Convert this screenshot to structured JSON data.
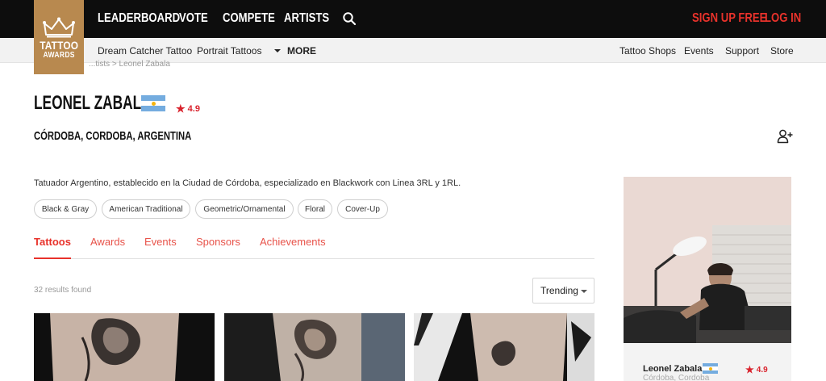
{
  "logo": {
    "line1": "TATTOO",
    "line2": "AWARDS",
    "icon": "crown-icon"
  },
  "nav": {
    "items": [
      "LEADERBOARD",
      "VOTE",
      "COMPETE",
      "ARTISTS"
    ],
    "search_icon": "search-icon",
    "signup": "SIGN UP FREE",
    "login": "LOG IN"
  },
  "subnav": {
    "left": [
      "Dream Catcher Tattoo",
      "Portrait Tattoos"
    ],
    "more": "MORE",
    "right": [
      "Tattoo Shops",
      "Events",
      "Support",
      "Store"
    ]
  },
  "breadcrumb": "...tists  >  Leonel Zabala",
  "profile": {
    "name": "LEONEL ZABALA",
    "flag": "Argentina",
    "rating": "4.9",
    "location": "CÓRDOBA, CORDOBA, ARGENTINA",
    "follow_icon": "add-user-icon",
    "bio": "Tatuador Argentino, establecido en la Ciudad de Córdoba, especializado en Blackwork con Linea 3RL y 1RL.",
    "tags": [
      "Black & Gray",
      "American Traditional",
      "Geometric/Ornamental",
      "Floral",
      "Cover-Up"
    ]
  },
  "tabs": [
    "Tattoos",
    "Awards",
    "Events",
    "Sponsors",
    "Achievements"
  ],
  "active_tab": "Tattoos",
  "results": "32 results found",
  "sort": {
    "selected": "Trending"
  },
  "card": {
    "name": "Leonel Zabala",
    "rating": "4.9",
    "location": "Córdoba, Cordoba"
  },
  "colors": {
    "accent": "#e8322b",
    "topbar": "#0d0d0d",
    "logo": "#b8894f",
    "flag_blue": "#74acdf"
  }
}
